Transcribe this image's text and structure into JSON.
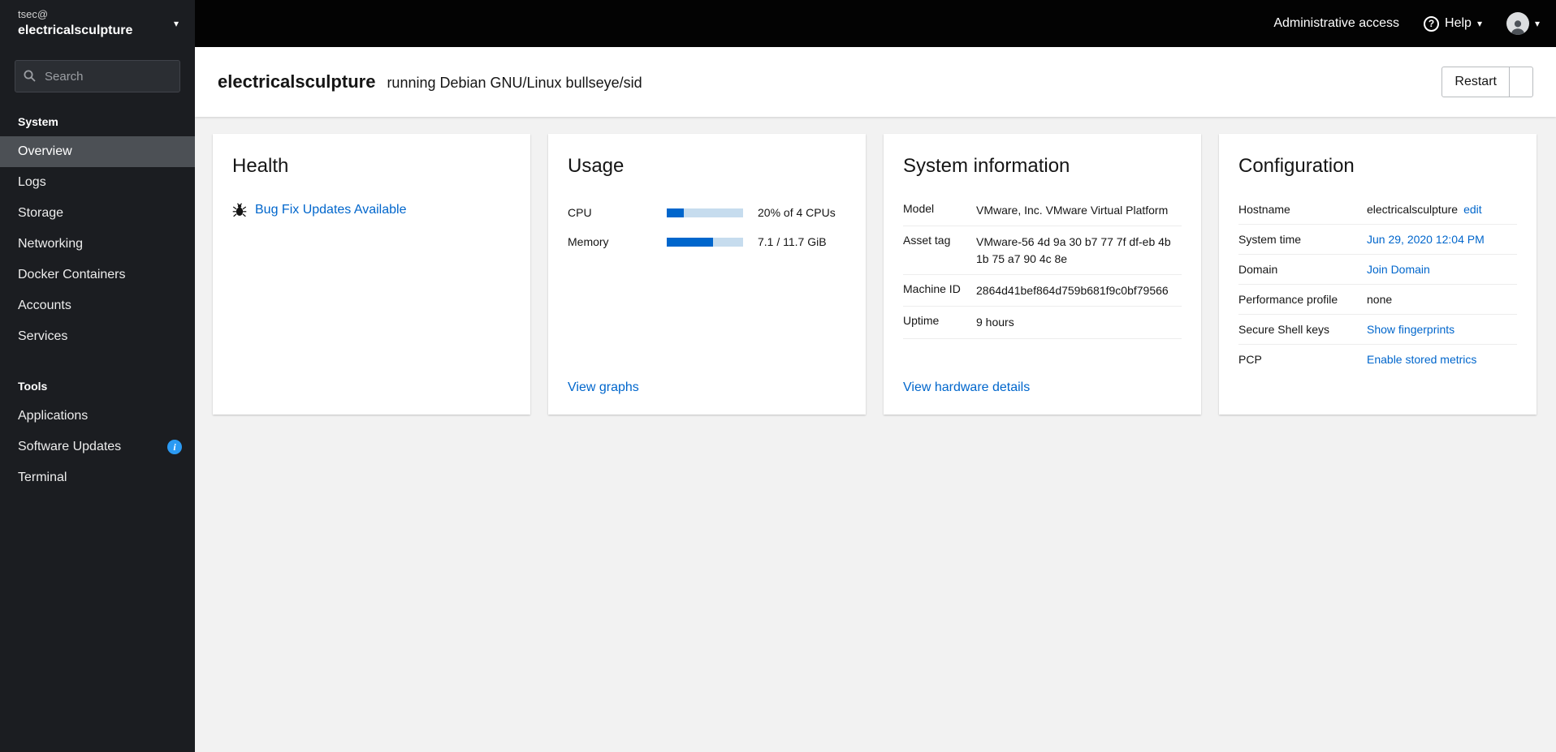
{
  "colors": {
    "link": "#0066cc",
    "progress_fill": "#0066cc",
    "progress_track": "#c6dcee",
    "info_badge": "#2b9af3",
    "sidebar_bg": "#1b1d21",
    "topbar_bg": "#030303",
    "nav_current_bg": "#4c5055"
  },
  "topbar": {
    "admin_access": "Administrative access",
    "help": "Help"
  },
  "sidebar": {
    "user": "tsec@",
    "host": "electricalsculpture",
    "search_placeholder": "Search",
    "system_section": "System",
    "tools_section": "Tools",
    "system_items": [
      "Overview",
      "Logs",
      "Storage",
      "Networking",
      "Docker Containers",
      "Accounts",
      "Services"
    ],
    "tools_items": [
      "Applications",
      "Software Updates",
      "Terminal"
    ]
  },
  "header": {
    "hostname": "electricalsculpture",
    "os": "running Debian GNU/Linux bullseye/sid",
    "restart": "Restart"
  },
  "health": {
    "title": "Health",
    "bug_link": "Bug Fix Updates Available"
  },
  "usage": {
    "title": "Usage",
    "rows": [
      {
        "label": "CPU",
        "percent": 22,
        "text": "20% of 4 CPUs"
      },
      {
        "label": "Memory",
        "percent": 61,
        "text": "7.1 / 11.7 GiB"
      }
    ],
    "view_graphs": "View graphs"
  },
  "sysinfo": {
    "title": "System information",
    "rows": [
      {
        "label": "Model",
        "value": "VMware, Inc. VMware Virtual Platform"
      },
      {
        "label": "Asset tag",
        "value": "VMware-56 4d 9a 30 b7 77 7f df-eb 4b 1b 75 a7 90 4c 8e"
      },
      {
        "label": "Machine ID",
        "value": "2864d41bef864d759b681f9c0bf79566"
      },
      {
        "label": "Uptime",
        "value": "9 hours"
      }
    ],
    "view_hardware": "View hardware details"
  },
  "config": {
    "title": "Configuration",
    "rows": {
      "hostname": {
        "label": "Hostname",
        "value": "electricalsculpture",
        "link": "edit"
      },
      "system_time": {
        "label": "System time",
        "link": "Jun 29, 2020 12:04 PM"
      },
      "domain": {
        "label": "Domain",
        "link": "Join Domain"
      },
      "performance_profile": {
        "label": "Performance profile",
        "value": "none"
      },
      "ssh_keys": {
        "label": "Secure Shell keys",
        "link": "Show fingerprints"
      },
      "pcp": {
        "label": "PCP",
        "link": "Enable stored metrics"
      }
    }
  }
}
